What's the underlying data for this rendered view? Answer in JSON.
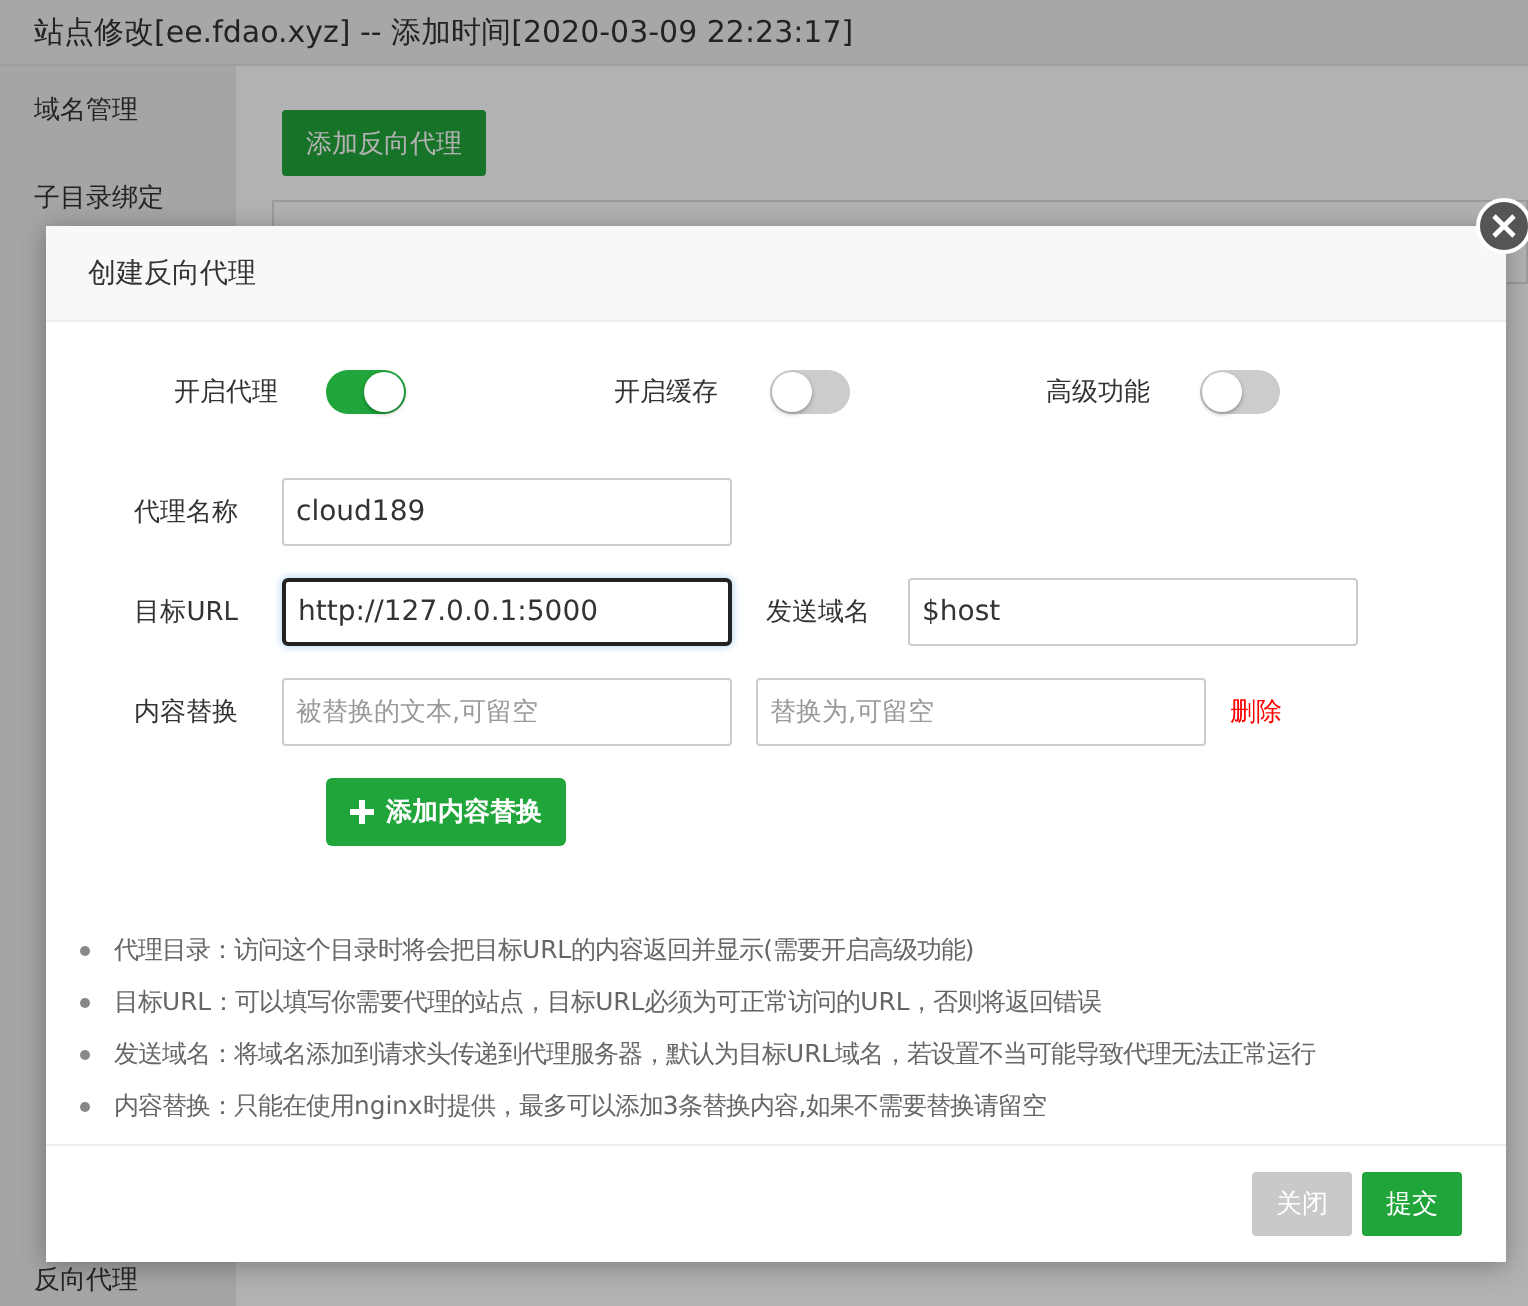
{
  "page_title": "站点修改[ee.fdao.xyz] -- 添加时间[2020-03-09 22:23:17]",
  "sidebar": {
    "items": [
      {
        "label": "域名管理"
      },
      {
        "label": "子目录绑定"
      },
      {
        "label": "反向代理"
      }
    ]
  },
  "add_proxy_button": "添加反向代理",
  "dialog": {
    "title": "创建反向代理",
    "switches": [
      {
        "label": "开启代理",
        "on": true
      },
      {
        "label": "开启缓存",
        "on": false
      },
      {
        "label": "高级功能",
        "on": false
      }
    ],
    "proxy_name": {
      "label": "代理名称",
      "value": "cloud189",
      "focused": false
    },
    "target_url": {
      "label": "目标URL",
      "value": "http://127.0.0.1:5000",
      "focused": true
    },
    "send_domain": {
      "label": "发送域名",
      "value": "$host",
      "focused": false
    },
    "content_replace": {
      "label": "内容替换",
      "from_placeholder": "被替换的文本,可留空",
      "to_placeholder": "替换为,可留空",
      "delete_link": "删除"
    },
    "add_replace_button": "添加内容替换",
    "notes": [
      "代理目录：访问这个目录时将会把目标URL的内容返回并显示(需要开启高级功能)",
      "目标URL：可以填写你需要代理的站点，目标URL必须为可正常访问的URL，否则将返回错误",
      "发送域名：将域名添加到请求头传递到代理服务器，默认为目标URL域名，若设置不当可能导致代理无法正常运行",
      "内容替换：只能在使用nginx时提供，最多可以添加3条替换内容,如果不需要替换请留空"
    ],
    "buttons": [
      {
        "label": "关闭",
        "kind": "secondary"
      },
      {
        "label": "提交",
        "kind": "primary"
      }
    ]
  }
}
